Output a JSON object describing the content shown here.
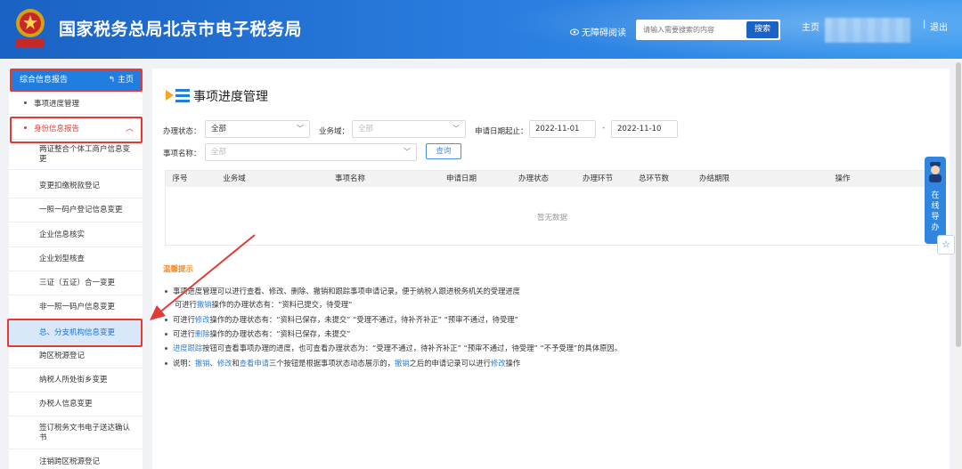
{
  "header": {
    "title": "国家税务总局北京市电子税务局",
    "accessibility": "无障碍阅读",
    "search_placeholder": "请输入需要搜索的内容",
    "search_button": "搜索",
    "nav_home": "主页",
    "separator": "|",
    "logout": "退出"
  },
  "sidebar": {
    "header_label": "综合信息报告",
    "home_label": "主页",
    "top_item": "事项进度管理",
    "group_label": "身份信息报告",
    "items": [
      "两证整合个体工商户信息变更",
      "变更扣缴税款登记",
      "一照一码户登记信息变更",
      "企业信息核实",
      "企业划型核查",
      "三证（五证）合一变更",
      "非一照一码户信息变更",
      "总、分支机构信息变更",
      "跨区税源登记",
      "纳税人所处街乡变更",
      "办税人信息变更",
      "签订税务文书电子送达确认书",
      "注销跨区税源登记"
    ]
  },
  "main": {
    "title": "事项进度管理",
    "filters": {
      "status_label": "办理状态：",
      "status_value": "全部",
      "domain_label": "业务域：",
      "domain_value": "全部",
      "date_label": "申请日期起止：",
      "date_from": "2022-11-01",
      "date_sep": "-",
      "date_to": "2022-11-10",
      "name_label": "事项名称：",
      "name_value": "全部",
      "query_button": "查询"
    },
    "table": {
      "columns": [
        "序号",
        "业务域",
        "事项名称",
        "申请日期",
        "办理状态",
        "办理环节",
        "总环节数",
        "办结期限",
        "操作"
      ],
      "empty_text": "暂无数据"
    },
    "tips": {
      "title": "温馨提示",
      "line1": "事项进度管理可以进行查看、修改、删除、撤销和跟踪事项申请记录，便于纳税人跟进税务机关的受理进度",
      "line2_pre": "可进行",
      "line2_link": "撤销",
      "line2_post": "操作的办理状态有：“资料已提交，待受理”",
      "line3_pre": "可进行",
      "line3_link": "修改",
      "line3_post": "操作的办理状态有：“资料已保存，未提交” “受理不通过，待补齐补正” “预审不通过，待受理”",
      "line4_pre": "可进行",
      "line4_link": "删除",
      "line4_post": "操作的办理状态有：“资料已保存，未提交”",
      "line5_link": "进度跟踪",
      "line5_post": "按钮可查看事项办理的进度，也可查看办理状态为：“受理不通过，待补齐补正” “预审不通过，待受理” “不予受理”的具体原因。",
      "line6_pre": "说明：",
      "line6_link1": "撤销",
      "line6_sep1": "、",
      "line6_link2": "修改",
      "line6_sep2": "和",
      "line6_link3": "查看申请",
      "line6_mid": "三个按钮是根据事项状态动态展示的，",
      "line6_link4": "撤销",
      "line6_mid2": "之后的申请记录可以进行",
      "line6_link5": "修改",
      "line6_end": "操作"
    }
  },
  "float": {
    "guide_text": [
      "在",
      "线",
      "导",
      "办"
    ]
  },
  "colors": {
    "header_blue": "#1a62c4",
    "accent_blue": "#1f7ee0",
    "highlight_red": "#e53935",
    "tips_orange": "#f08c2b",
    "link_blue": "#2f7fd8"
  }
}
